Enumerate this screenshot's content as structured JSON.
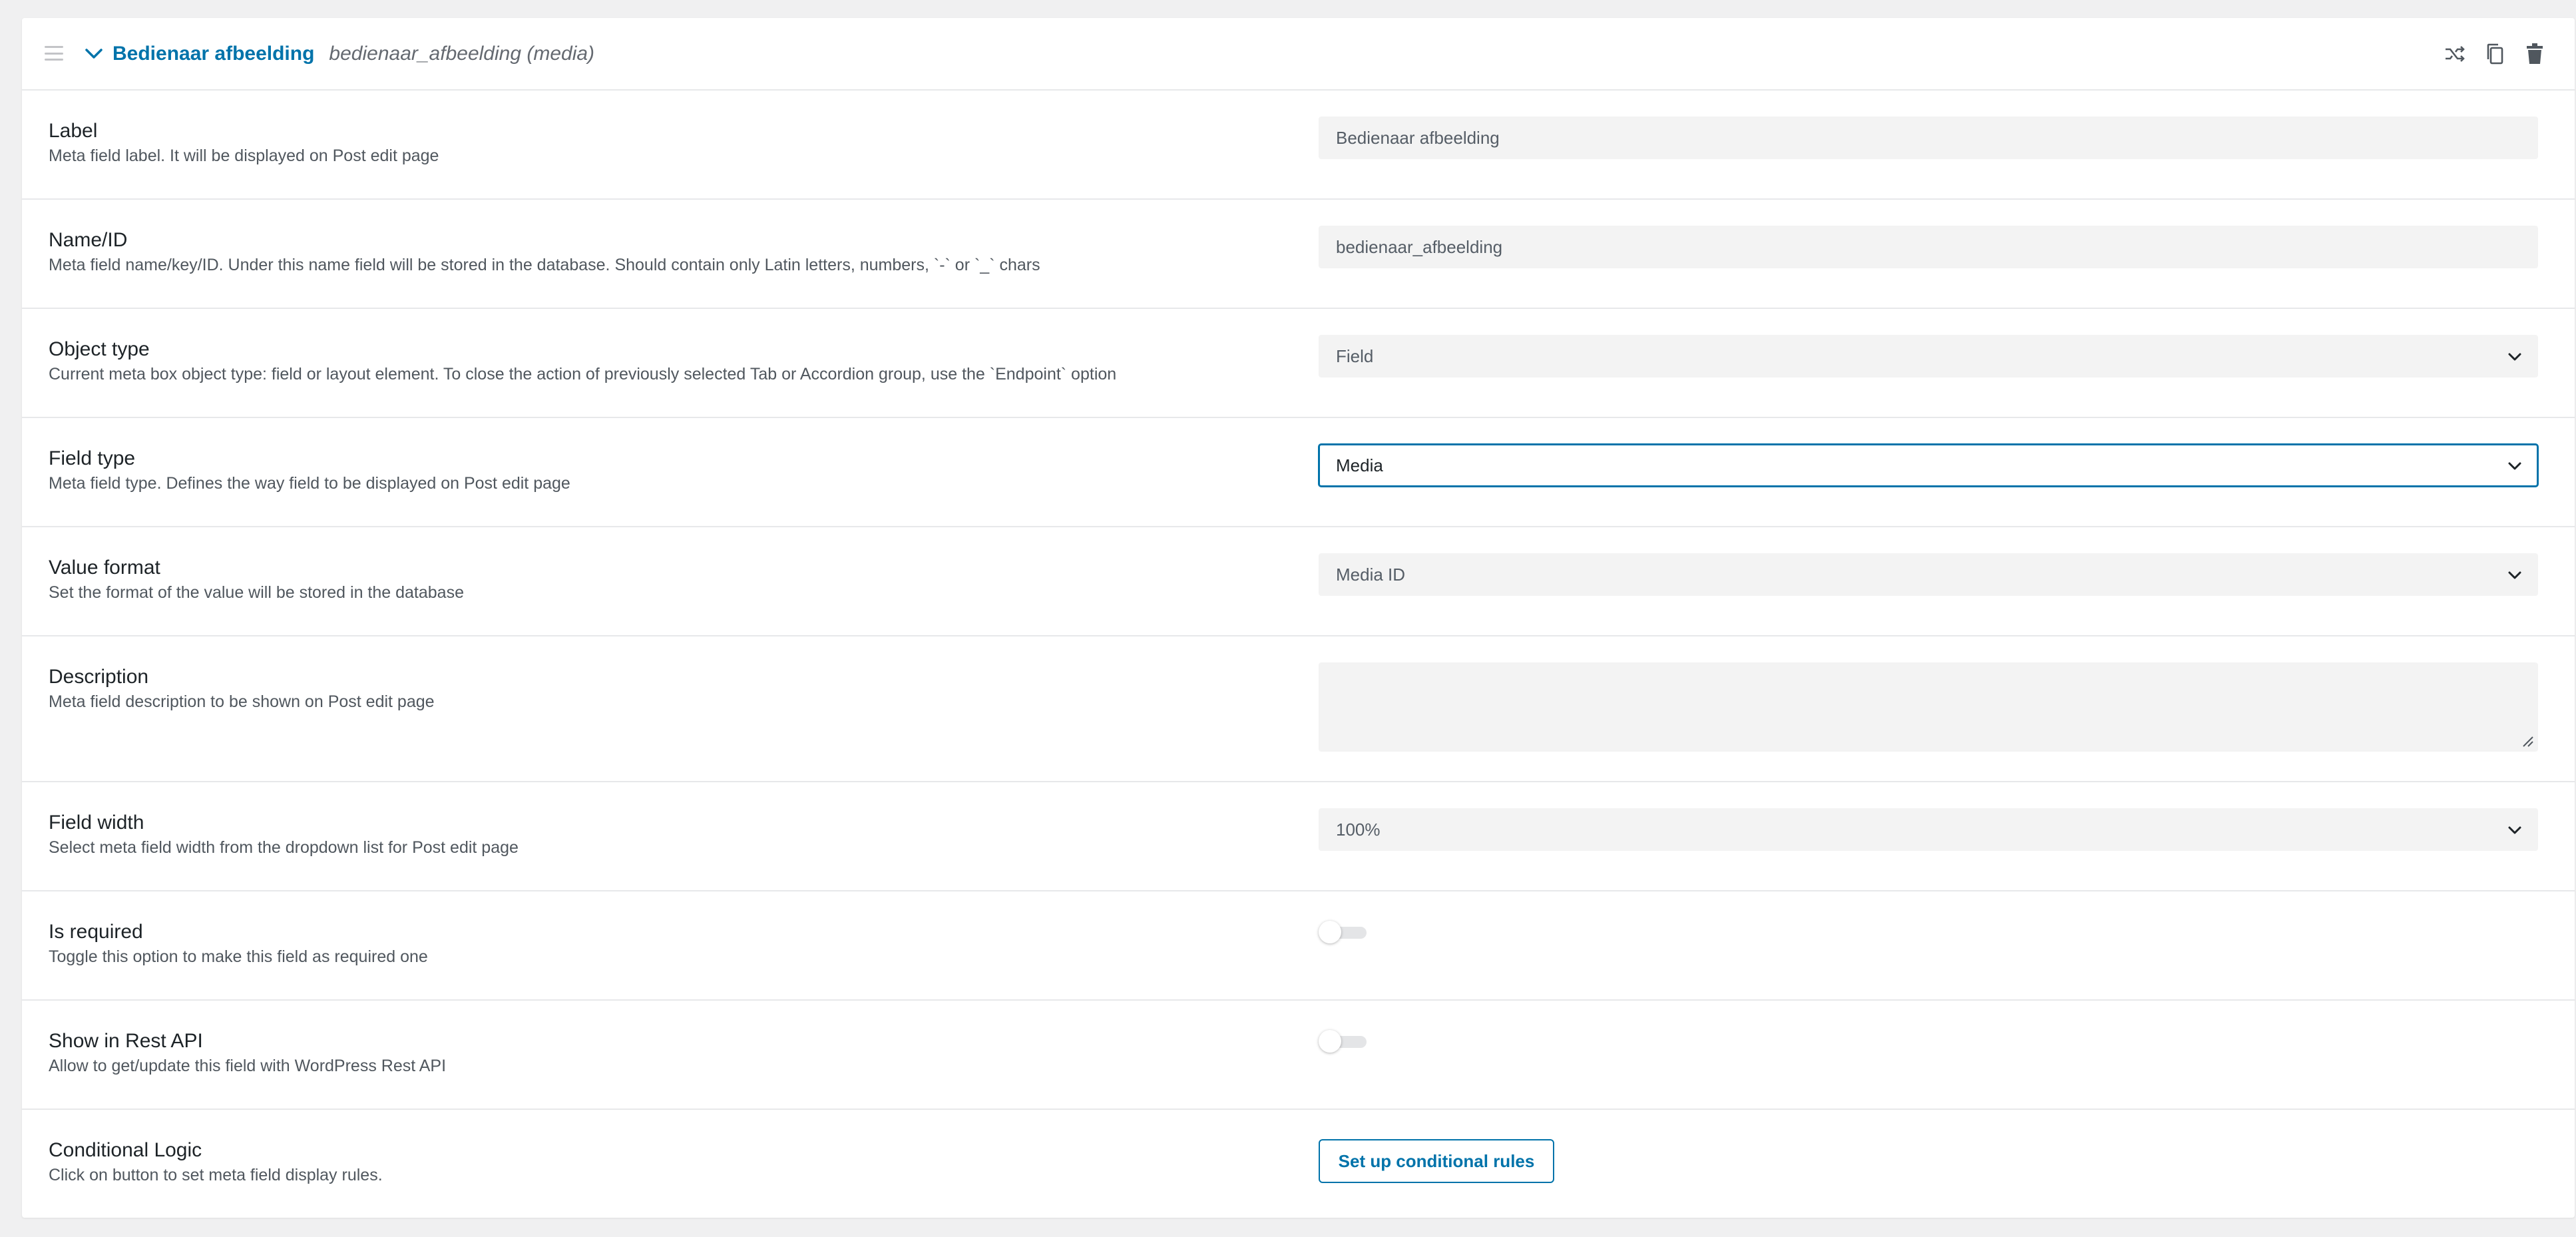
{
  "header": {
    "title": "Bedienaar afbeelding",
    "subtitle": "bedienaar_afbeelding (media)",
    "actions": [
      "shuffle-icon",
      "copy-icon",
      "trash-icon"
    ]
  },
  "fields": {
    "label": {
      "label": "Label",
      "description": "Meta field label. It will be displayed on Post edit page",
      "value": "Bedienaar afbeelding"
    },
    "name": {
      "label": "Name/ID",
      "description": "Meta field name/key/ID. Under this name field will be stored in the database. Should contain only Latin letters, numbers, `-` or `_` chars",
      "value": "bedienaar_afbeelding"
    },
    "object_type": {
      "label": "Object type",
      "description": "Current meta box object type: field or layout element. To close the action of previously selected Tab or Accordion group, use the `Endpoint` option",
      "value": "Field"
    },
    "field_type": {
      "label": "Field type",
      "description": "Meta field type. Defines the way field to be displayed on Post edit page",
      "value": "Media"
    },
    "value_format": {
      "label": "Value format",
      "description": "Set the format of the value will be stored in the database",
      "value": "Media ID"
    },
    "description": {
      "label": "Description",
      "description": "Meta field description to be shown on Post edit page",
      "value": ""
    },
    "field_width": {
      "label": "Field width",
      "description": "Select meta field width from the dropdown list for Post edit page",
      "value": "100%"
    },
    "is_required": {
      "label": "Is required",
      "description": "Toggle this option to make this field as required one",
      "enabled": false
    },
    "show_in_rest": {
      "label": "Show in Rest API",
      "description": "Allow to get/update this field with WordPress Rest API",
      "enabled": false
    },
    "conditional_logic": {
      "label": "Conditional Logic",
      "description": "Click on button to set meta field display rules.",
      "button_label": "Set up conditional rules"
    }
  },
  "colors": {
    "accent": "#0073aa",
    "input_bg": "#f3f3f3",
    "border": "#e7e8ea"
  }
}
